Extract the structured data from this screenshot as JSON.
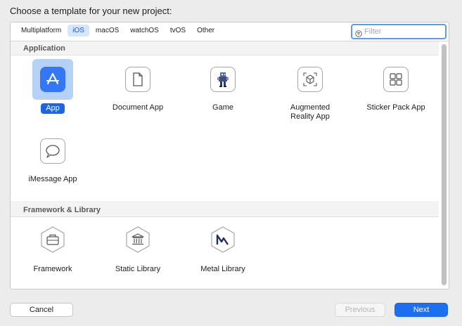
{
  "dialog": {
    "title": "Choose a template for your new project:"
  },
  "tabs": [
    {
      "label": "Multiplatform",
      "active": false
    },
    {
      "label": "iOS",
      "active": true
    },
    {
      "label": "macOS",
      "active": false
    },
    {
      "label": "watchOS",
      "active": false
    },
    {
      "label": "tvOS",
      "active": false
    },
    {
      "label": "Other",
      "active": false
    }
  ],
  "filter": {
    "placeholder": "Filter",
    "value": ""
  },
  "sections": {
    "application": {
      "title": "Application",
      "templates": [
        {
          "label_lines": [
            "App"
          ],
          "icon": "app-store-a-icon",
          "selected": true
        },
        {
          "label_lines": [
            "Document App"
          ],
          "icon": "document-icon",
          "selected": false
        },
        {
          "label_lines": [
            "Game"
          ],
          "icon": "game-sprite-icon",
          "selected": false
        },
        {
          "label_lines": [
            "Augmented",
            "Reality App"
          ],
          "icon": "ar-cube-icon",
          "selected": false
        },
        {
          "label_lines": [
            "Sticker Pack App"
          ],
          "icon": "sticker-grid-icon",
          "selected": false
        },
        {
          "label_lines": [
            "iMessage App"
          ],
          "icon": "speech-bubble-icon",
          "selected": false
        }
      ]
    },
    "framework_library": {
      "title": "Framework & Library",
      "templates": [
        {
          "label_lines": [
            "Framework"
          ],
          "icon": "toolbox-hexagon-icon",
          "selected": false
        },
        {
          "label_lines": [
            "Static Library"
          ],
          "icon": "library-building-icon",
          "selected": false
        },
        {
          "label_lines": [
            "Metal Library"
          ],
          "icon": "metal-m-icon",
          "selected": false
        }
      ]
    }
  },
  "buttons": {
    "cancel": "Cancel",
    "previous": "Previous",
    "next": "Next"
  },
  "colors": {
    "accent": "#1d6ff2",
    "selection_bg": "#b5d1f5",
    "active_tab_bg": "#d6e5fa"
  }
}
